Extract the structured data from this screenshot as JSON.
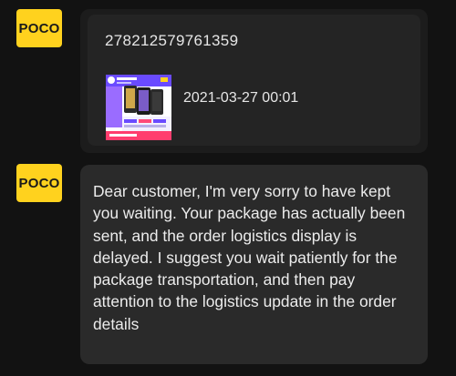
{
  "messages": [
    {
      "sender_avatar_label": "POCO",
      "type": "order-card",
      "order_id": "278212579761359",
      "order_time": "2021-03-27 00:01",
      "product_thumbnail": "product-image-icon"
    },
    {
      "sender_avatar_label": "POCO",
      "type": "text",
      "text": "Dear customer, I'm very sorry to have kept you waiting. Your package has actually been sent, and the order logistics display is delayed. I suggest you wait patiently for the package transportation, and then pay attention to the logistics update in the order details"
    }
  ],
  "colors": {
    "background": "#121212",
    "avatar_bg": "#ffd21e",
    "bubble_bg": "#2a2a2a",
    "text": "#ececec"
  }
}
